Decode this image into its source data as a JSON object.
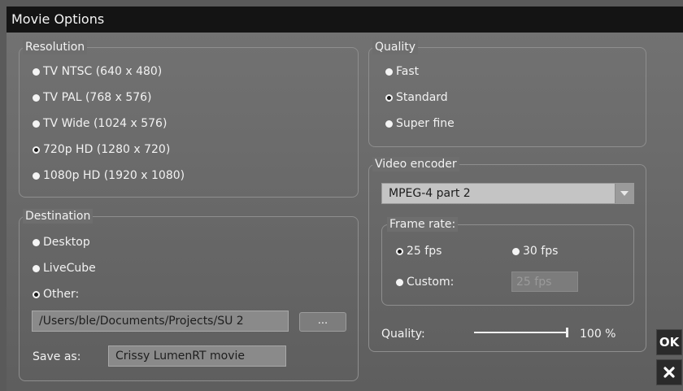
{
  "window": {
    "title": "Movie Options"
  },
  "resolution": {
    "legend": "Resolution",
    "options": [
      {
        "label": "TV NTSC (640 x 480)",
        "selected": false
      },
      {
        "label": "TV PAL (768 x 576)",
        "selected": false
      },
      {
        "label": "TV Wide (1024 x 576)",
        "selected": false
      },
      {
        "label": "720p HD (1280 x 720)",
        "selected": true
      },
      {
        "label": "1080p HD (1920 x 1080)",
        "selected": false
      }
    ]
  },
  "destination": {
    "legend": "Destination",
    "options": [
      {
        "label": "Desktop",
        "selected": false
      },
      {
        "label": "LiveCube",
        "selected": false
      },
      {
        "label": "Other:",
        "selected": true
      }
    ],
    "path_value": "/Users/ble/Documents/Projects/SU 2",
    "browse_label": "...",
    "save_as_label": "Save as:",
    "save_as_value": "Crissy LumenRT movie"
  },
  "quality": {
    "legend": "Quality",
    "options": [
      {
        "label": "Fast",
        "selected": false
      },
      {
        "label": "Standard",
        "selected": true
      },
      {
        "label": "Super fine",
        "selected": false
      }
    ]
  },
  "video_encoder": {
    "legend": "Video encoder",
    "codec": "MPEG-4 part 2",
    "frame_rate": {
      "legend": "Frame rate:",
      "options": [
        {
          "label": "25 fps",
          "selected": true
        },
        {
          "label": "30 fps",
          "selected": false
        },
        {
          "label": "Custom:",
          "selected": false
        }
      ],
      "custom_value": "25 fps"
    },
    "quality_label": "Quality:",
    "quality_value": "100 %",
    "quality_level": 1.0
  },
  "actions": {
    "ok_label": "OK",
    "cancel_icon": "close-icon"
  }
}
